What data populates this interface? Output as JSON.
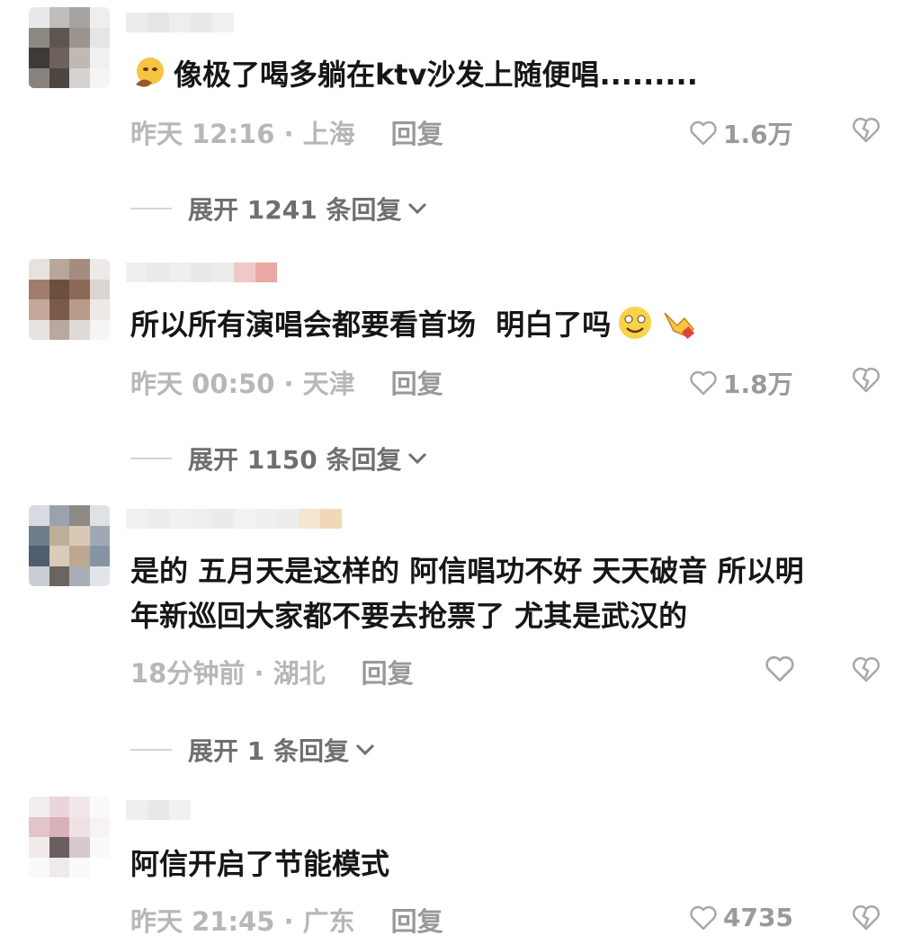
{
  "comments": [
    {
      "text": "像极了喝多躺在ktv沙发上随便唱.........",
      "time_location": "昨天 12:16 · 上海",
      "reply_label": "回复",
      "likes": "1.6万",
      "expand_label": "展开 1241 条回复"
    },
    {
      "text": "所以所有演唱会都要看首场  明白了吗",
      "time_location": "昨天 00:50 · 天津",
      "reply_label": "回复",
      "likes": "1.8万",
      "expand_label": "展开 1150 条回复"
    },
    {
      "text": "是的 五月天是这样的 阿信唱功不好 天天破音 所以明\n年新巡回大家都不要去抢票了 尤其是武汉的",
      "time_location": "18分钟前 · 湖北",
      "reply_label": "回复",
      "likes": "",
      "expand_label": "展开 1 条回复"
    },
    {
      "text": "阿信开启了节能模式",
      "time_location": "昨天 21:45 · 广东",
      "reply_label": "回复",
      "likes": "4735",
      "expand_label": ""
    }
  ],
  "icons": {
    "like": "heart-outline-icon",
    "dislike": "broken-heart-icon",
    "expand": "chevron-down-icon"
  },
  "colors": {
    "text": "#161616",
    "meta": "#b7b7b7",
    "expand": "#6f6f6f"
  }
}
